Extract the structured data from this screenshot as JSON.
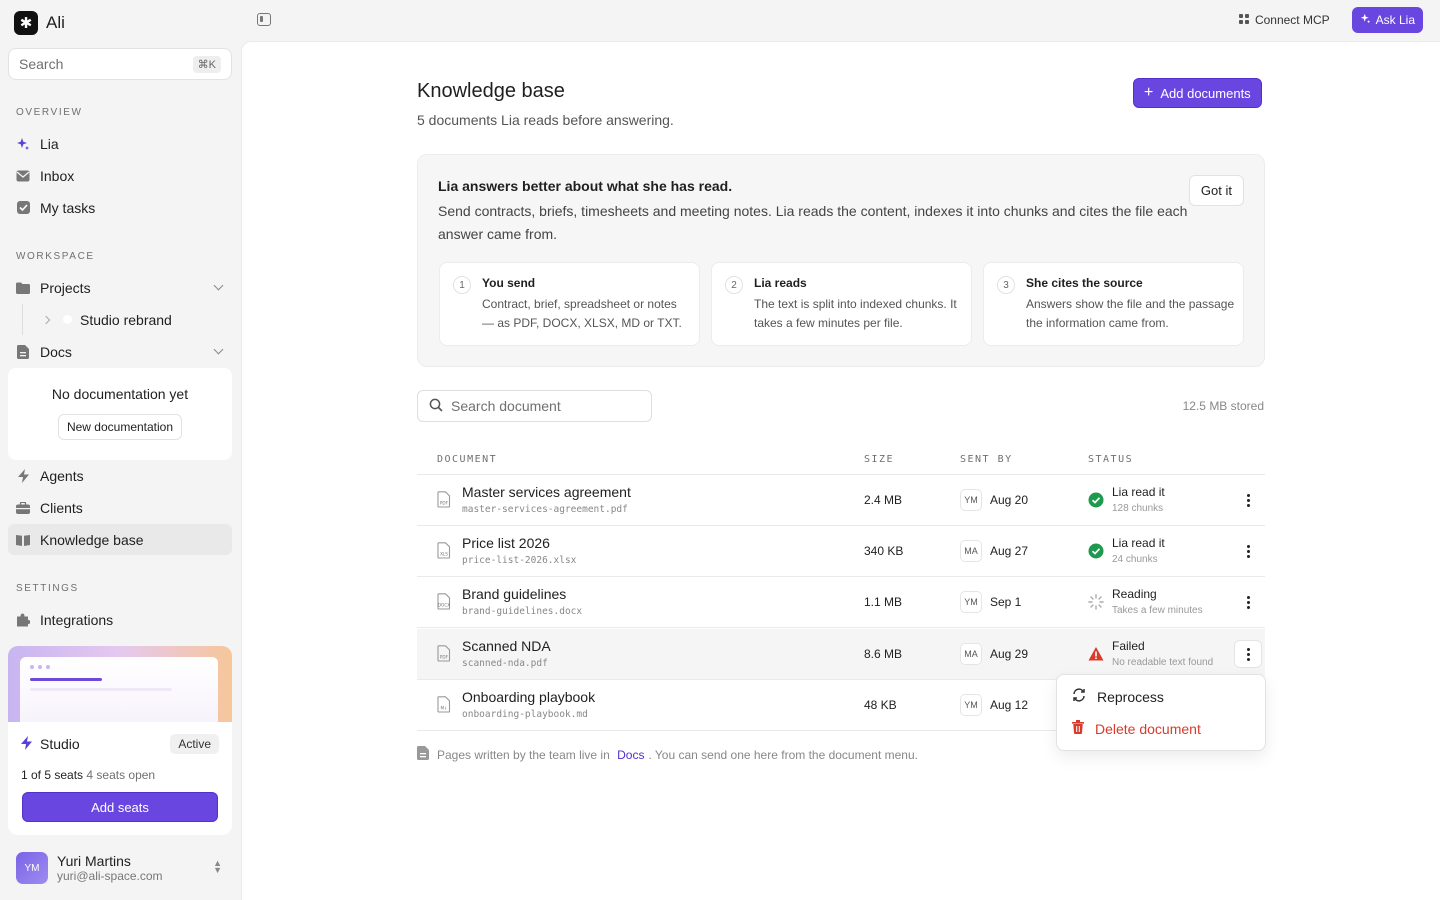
{
  "app": {
    "name": "Ali",
    "logo_glyph": "✱"
  },
  "sidebar": {
    "search_placeholder": "Search",
    "search_shortcut": "⌘K",
    "sections": {
      "overview": "OVERVIEW",
      "workspace": "WORKSPACE",
      "settings": "SETTINGS"
    },
    "overview_items": [
      {
        "label": "Lia",
        "icon": "sparkle-icon"
      },
      {
        "label": "Inbox",
        "icon": "mail-icon"
      },
      {
        "label": "My tasks",
        "icon": "checkbox-icon"
      }
    ],
    "workspace_items": {
      "projects": "Projects",
      "studio_rebrand": "Studio rebrand",
      "docs": "Docs",
      "agents": "Agents",
      "clients": "Clients",
      "knowledge_base": "Knowledge base"
    },
    "docs_empty": {
      "title": "No documentation yet",
      "button": "New documentation"
    },
    "settings_items": {
      "integrations": "Integrations"
    },
    "plan": {
      "name": "Studio",
      "status": "Active",
      "seats_used": "1 of 5 seats",
      "seats_open": "4 seats open",
      "button": "Add seats"
    },
    "user": {
      "initials": "YM",
      "name": "Yuri Martins",
      "email": "yuri@ali-space.com"
    }
  },
  "topbar": {
    "connect": "Connect MCP",
    "ask": "Ask Lia"
  },
  "page": {
    "title": "Knowledge base",
    "subtitle": "5 documents Lia reads before answering.",
    "add_button": "Add documents"
  },
  "info": {
    "heading": "Lia answers better about what she has read.",
    "description": "Send contracts, briefs, timesheets and meeting notes. Lia reads the content, indexes it into chunks and cites the file each answer came from.",
    "dismiss": "Got it",
    "steps": [
      {
        "num": "1",
        "title": "You send",
        "desc": "Contract, brief, spreadsheet or notes — as PDF, DOCX, XLSX, MD or TXT."
      },
      {
        "num": "2",
        "title": "Lia reads",
        "desc": "The text is split into indexed chunks. It takes a few minutes per file."
      },
      {
        "num": "3",
        "title": "She cites the source",
        "desc": "Answers show the file and the passage the information came from."
      }
    ]
  },
  "table": {
    "search_placeholder": "Search document",
    "stored": "12.5 MB stored",
    "headers": {
      "document": "DOCUMENT",
      "size": "SIZE",
      "sent_by": "SENT BY",
      "status": "STATUS"
    },
    "rows": [
      {
        "name": "Master services agreement",
        "file": "master-services-agreement.pdf",
        "type": "PDF",
        "size": "2.4 MB",
        "initials": "YM",
        "date": "Aug 20",
        "status": "Lia read it",
        "status_sub": "128 chunks",
        "state": "done"
      },
      {
        "name": "Price list 2026",
        "file": "price-list-2026.xlsx",
        "type": "XLS",
        "size": "340 KB",
        "initials": "MA",
        "date": "Aug 27",
        "status": "Lia read it",
        "status_sub": "24 chunks",
        "state": "done"
      },
      {
        "name": "Brand guidelines",
        "file": "brand-guidelines.docx",
        "type": "DOCX",
        "size": "1.1 MB",
        "initials": "YM",
        "date": "Sep 1",
        "status": "Reading",
        "status_sub": "Takes a few minutes",
        "state": "reading"
      },
      {
        "name": "Scanned NDA",
        "file": "scanned-nda.pdf",
        "type": "PDF",
        "size": "8.6 MB",
        "initials": "MA",
        "date": "Aug 29",
        "status": "Failed",
        "status_sub": "No readable text found",
        "state": "failed"
      },
      {
        "name": "Onboarding playbook",
        "file": "onboarding-playbook.md",
        "type": "M↓",
        "size": "48 KB",
        "initials": "YM",
        "date": "Aug 12",
        "status": "",
        "status_sub": "",
        "state": "none"
      }
    ]
  },
  "footer": {
    "before": "Pages written by the team live in",
    "link": "Docs",
    "after": ". You can send one here from the document menu."
  },
  "menu": {
    "reprocess": "Reprocess",
    "delete": "Delete document"
  },
  "colors": {
    "accent": "#6a46e0",
    "success": "#1e9a4f",
    "danger": "#d63b2b"
  }
}
